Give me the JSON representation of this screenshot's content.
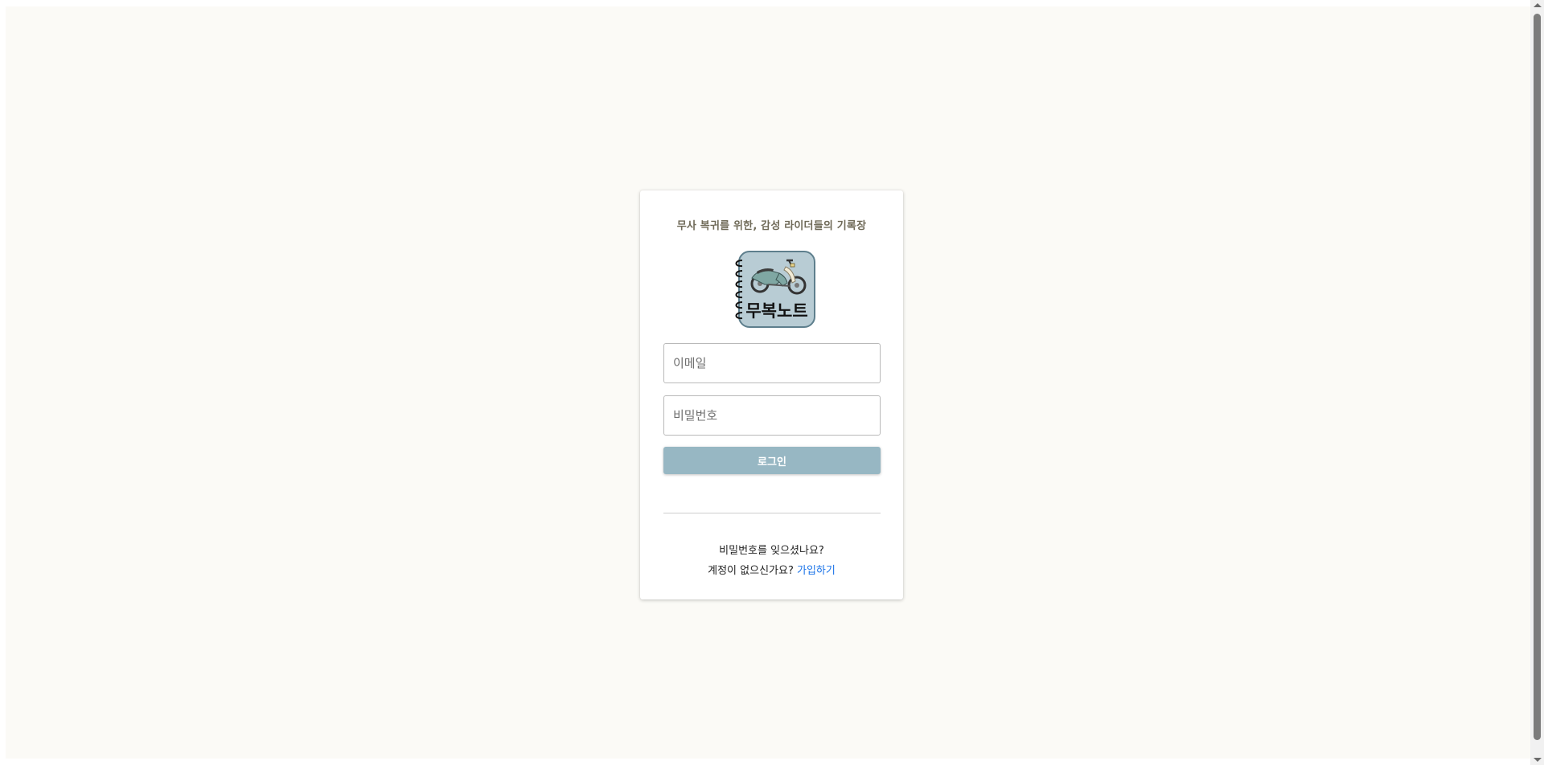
{
  "login": {
    "tagline": "무사 복귀를 위한, 감성 라이더들의 기록장",
    "logo_text": "무복노트",
    "email_placeholder": "이메일",
    "password_placeholder": "비밀번호",
    "login_label": "로그인",
    "forgot_password": "비밀번호를 잊으셨나요?",
    "no_account": "계정이 없으신가요?",
    "signup_link": "가입하기"
  },
  "colors": {
    "page_background": "#fbfaf6",
    "login_button": "#97b7c3",
    "logo_background": "#b8ccd4",
    "link": "#1a73e8"
  }
}
